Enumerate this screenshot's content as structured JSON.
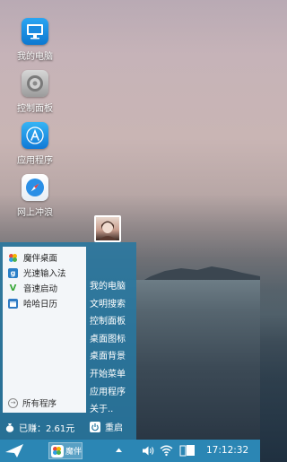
{
  "desktop": {
    "icons": [
      {
        "label": "我的电脑",
        "icon": "computer-icon"
      },
      {
        "label": "控制面板",
        "icon": "control-panel-icon"
      },
      {
        "label": "应用程序",
        "icon": "app-store-icon"
      },
      {
        "label": "网上冲浪",
        "icon": "safari-compass-icon"
      }
    ]
  },
  "start_menu": {
    "pinned": [
      {
        "label": "魔伴桌面",
        "icon": "mobanwindows-icon"
      },
      {
        "label": "光速输入法",
        "icon": "input-method-icon"
      },
      {
        "label": "音速启动",
        "icon": "launcher-icon"
      },
      {
        "label": "哈哈日历",
        "icon": "calendar-icon"
      }
    ],
    "all_programs": "所有程序",
    "earned": "已赚：2.61元",
    "right_items": [
      "我的电脑",
      "文明搜索",
      "控制面板",
      "桌面图标",
      "桌面背景",
      "开始菜单",
      "应用程序",
      "关于.."
    ],
    "restart": "重启"
  },
  "taskbar": {
    "app_label": "魔伴",
    "clock": "17:12:32"
  },
  "colors": {
    "taskbar": "#2b86b4",
    "menu_frame": "#2878a0",
    "menu_panel": "#f3f6f9"
  }
}
